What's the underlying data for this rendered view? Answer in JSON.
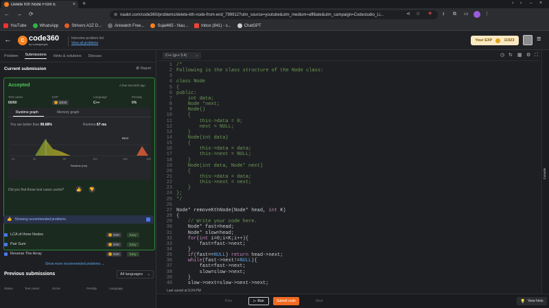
{
  "browser": {
    "tab_title": "Delete Kth Node From E",
    "url": "naukri.com/code360/problems/delete-kth-node-from-end_799912?utm_source=youtube&utm_medium=affiliate&utm_campaign=Codestudio_Li...",
    "bookmarks": [
      "YouTube",
      "WhatsApp",
      "Strivers A2Z D...",
      "Aniwatch Free...",
      "Sujal465 - Nau...",
      "Inbox (841) - s...",
      "ChatGPT"
    ]
  },
  "header": {
    "logo_text": "code360",
    "logo_sub": "by codingninjas",
    "interview_label": "Interview problem list",
    "view_all": "View all problems",
    "exp_label": "Your EXP",
    "exp_value": "11923"
  },
  "left": {
    "tabs": [
      "Problem",
      "Submissions",
      "Hints & solutions",
      "Discuss"
    ],
    "current_submission": "Current submission",
    "report": "Report",
    "status": "Accepted",
    "time_ago": "A few seconds ago",
    "stats": {
      "test_cases_label": "Test cases",
      "test_cases_value": "60/60",
      "exp_label": "EXP",
      "exp_value": "30/30",
      "language_label": "Language",
      "language_value": "C++",
      "penalty_label": "Penalty",
      "penalty_value": "0%"
    },
    "graph_tabs": [
      "Runtime graph",
      "Memory graph"
    ],
    "better_than_label": "You are better than",
    "better_than_value": "99.68%",
    "runtime_label": "Runtime",
    "runtime_value": "67 ms",
    "best_label": "Best",
    "xaxis_ticks": [
      "20",
      "40",
      "80",
      "120",
      "160",
      "198"
    ],
    "xaxis_label": "Runtime (ms)",
    "feedback_question": "Did you find these test cases useful?",
    "recommended_label": "Showing recommended problems",
    "recommended": [
      {
        "name": "LCA of three Nodes",
        "exp": "0/40",
        "difficulty": "Easy"
      },
      {
        "name": "Pair Sum",
        "exp": "0/40",
        "difficulty": "Easy"
      },
      {
        "name": "Reverse The Array",
        "exp": "0/40",
        "difficulty": "Easy"
      }
    ],
    "show_more": "Show more recommended problems",
    "previous_submissions": "Previous submissions",
    "all_languages": "All languages",
    "columns": [
      "Status",
      "Test cases",
      "Score",
      "Penalty",
      "Language"
    ]
  },
  "editor": {
    "language": "C++ (g++ 5.4)",
    "last_saved": "Last saved at 9:24 PM",
    "lines": [
      "/*",
      "Following is the class structure of the Node class:",
      "",
      "class Node",
      "{",
      "public:",
      "    int data;",
      "    Node *next;",
      "    Node()",
      "    {",
      "        this->data = 0;",
      "        next = NULL;",
      "    }",
      "    Node(int data)",
      "    {",
      "        this->data = data;",
      "        this->next = NULL;",
      "    }",
      "    Node(int data, Node* next)",
      "    {",
      "        this->data = data;",
      "        this->next = next;",
      "    }",
      "};",
      "*/",
      "",
      "Node* removeKthNode(Node* head, int K)",
      "{",
      "    // Write your code here.",
      "    Node* fast=head;",
      "    Node* slow=head;",
      "    for(int i=0;i<K;i++){",
      "        fast=fast->next;",
      "    }",
      "    if(fast==NULL) return head->next;",
      "    while(fast->next!=NULL){",
      "        fast=fast->next;",
      "        slow=slow->next;",
      "    }",
      "    slow->next=slow->next->next;"
    ]
  },
  "bottom": {
    "prev": "Prev",
    "run": "Run",
    "submit": "Submit code",
    "next": "Next",
    "view_hints": "View hints"
  },
  "console_label": "Console"
}
